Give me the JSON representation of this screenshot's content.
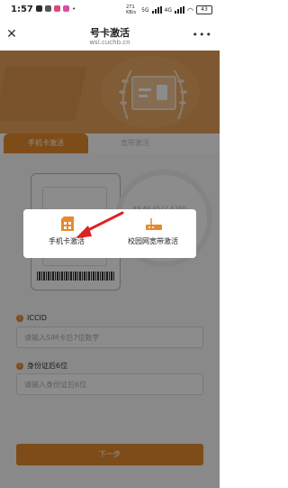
{
  "status_bar": {
    "time": "1:57",
    "net_speed": "271 KB/s",
    "signal_labels": [
      "5G",
      "4G"
    ],
    "battery": "43"
  },
  "titlebar": {
    "close_icon": "close-icon",
    "title": "号卡激活",
    "subtitle": "wsl.cuchb.cn",
    "more_icon": "more-icon"
  },
  "tabs": [
    {
      "label": "手机卡激活",
      "active": true
    },
    {
      "label": "宽带激活",
      "active": false
    }
  ],
  "sim_preview": {
    "magnifier_text": "89 86 0522 6700"
  },
  "fields": [
    {
      "label": "ICCID",
      "placeholder": "请输入SIM卡后7位数字"
    },
    {
      "label": "身份证后6位",
      "placeholder": "请输入身份证后6位"
    }
  ],
  "next_button": "下一步",
  "modal": {
    "options": [
      {
        "label": "手机卡激活",
        "icon": "sim-card-icon"
      },
      {
        "label": "校园网宽带激活",
        "icon": "router-icon"
      }
    ]
  },
  "colors": {
    "accent": "#e58a2f",
    "banner": "#e6a15a",
    "arrow": "#e02020"
  }
}
